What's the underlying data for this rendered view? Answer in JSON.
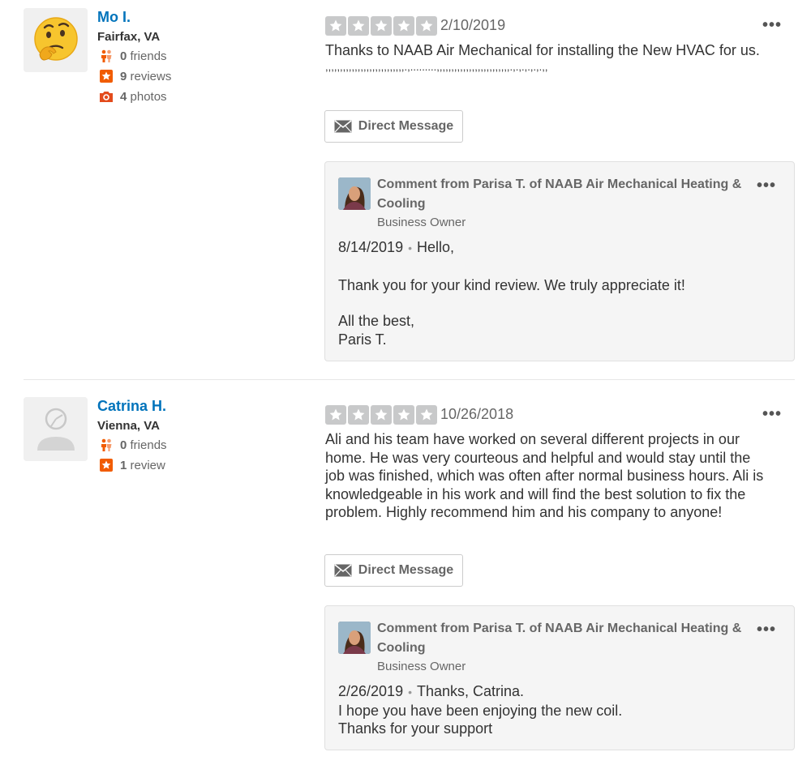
{
  "colors": {
    "link_blue": "#0073bb",
    "star_empty": "#c8c9ca",
    "stat_orange": "#f15c00",
    "stat_red": "#e34b1c"
  },
  "reviews": [
    {
      "user": {
        "name": "Mo I.",
        "location": "Fairfax, VA",
        "avatar_icon": "thinking-face-emoji",
        "stats": [
          {
            "icon": "friends-icon",
            "count": "0",
            "label": "friends"
          },
          {
            "icon": "review-star-icon",
            "count": "9",
            "label": "reviews"
          },
          {
            "icon": "camera-icon",
            "count": "4",
            "label": "photos"
          }
        ]
      },
      "rating": 0,
      "date": "2/10/2019",
      "text_line1": "Thanks to NAAB Air Mechanical for installing the New HVAC for us.",
      "text_line2": ",,,,,,,,,,,,,,,,,,,,,,,,,,,.,.........,,,,,,,,,,,,,,,,,,,,,,,,,.,.,.,.,.,.,,",
      "dm_label": "Direct Message",
      "owner_comment": {
        "title": "Comment from Parisa T. of NAAB Air Mechanical Heating & Cooling",
        "role": "Business Owner",
        "date": "8/14/2019",
        "greeting": "Hello,",
        "para1": "Thank you for your kind review. We truly appreciate it!",
        "sign1": "All the best,",
        "sign2": "Paris T."
      }
    },
    {
      "user": {
        "name": "Catrina H.",
        "location": "Vienna, VA",
        "avatar_icon": "default-user-icon",
        "stats": [
          {
            "icon": "friends-icon",
            "count": "0",
            "label": "friends"
          },
          {
            "icon": "review-star-icon",
            "count": "1",
            "label": "review"
          }
        ]
      },
      "rating": 0,
      "date": "10/26/2018",
      "text_lines": [
        "Ali and his team have worked on several different projects in our",
        "home. He was very courteous and helpful and would stay until the",
        "job was finished, which was often after normal business hours. Ali is",
        "knowledgeable in his work and will find the best solution to fix the",
        "problem. Highly recommend him and his company to anyone!"
      ],
      "dm_label": "Direct Message",
      "owner_comment": {
        "title": "Comment from Parisa T. of NAAB Air Mechanical Heating & Cooling",
        "role": "Business Owner",
        "date": "2/26/2019",
        "greeting": "Thanks, Catrina.",
        "line2": "I hope you have been enjoying the new coil.",
        "line3": "Thanks for your support"
      }
    }
  ]
}
